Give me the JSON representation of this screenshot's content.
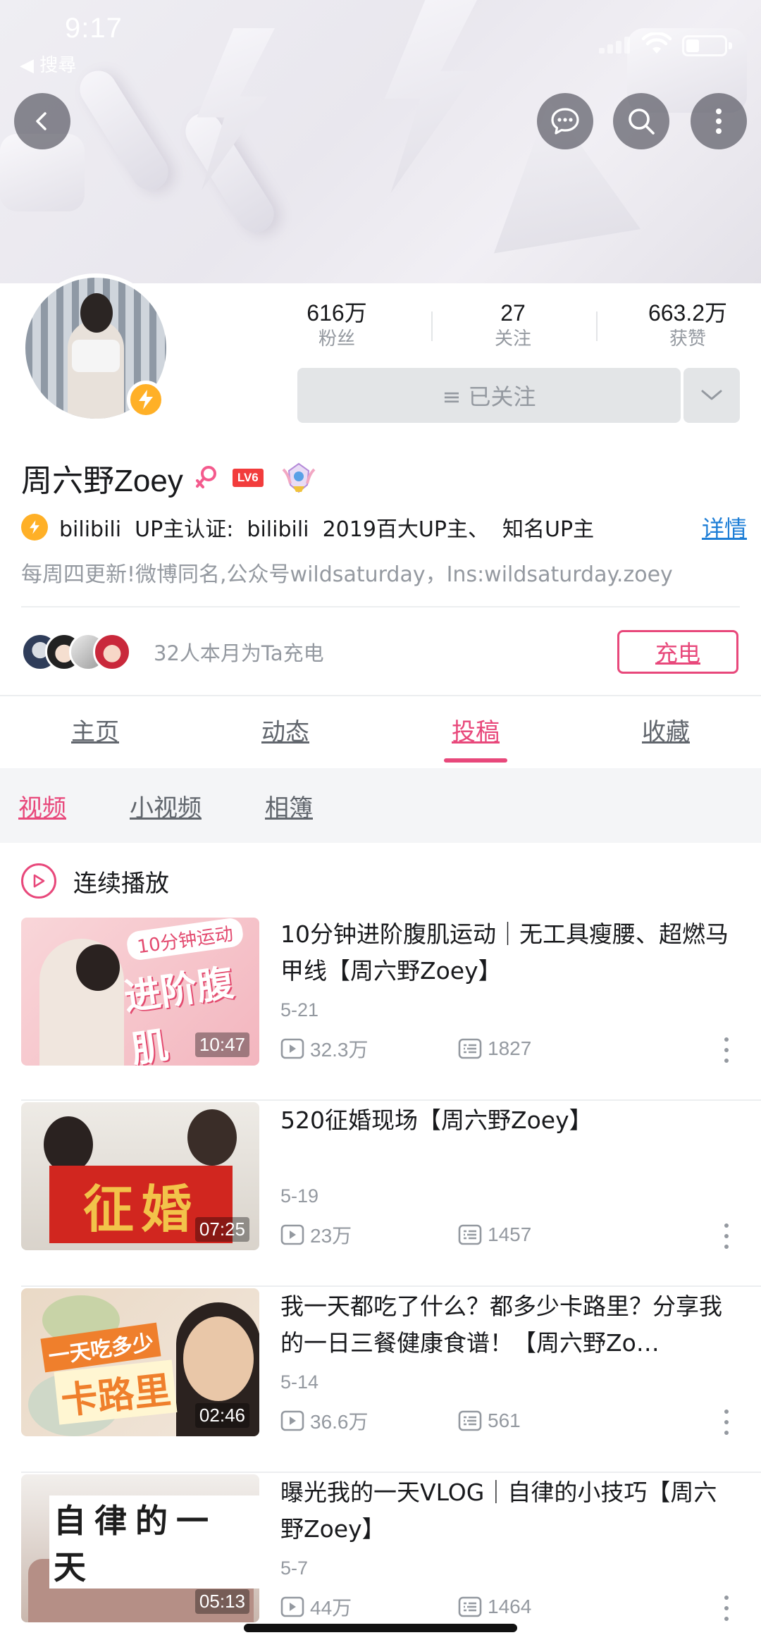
{
  "status_bar": {
    "time": "9:17",
    "back_label": "◀ 搜尋"
  },
  "profile": {
    "stats": [
      {
        "value": "616万",
        "label": "粉丝"
      },
      {
        "value": "27",
        "label": "关注"
      },
      {
        "value": "663.2万",
        "label": "获赞"
      }
    ],
    "follow_button_label": "≡ 已关注",
    "name": "周六野Zoey",
    "level_badge": "LV6",
    "verify_text": "bilibili  UP主认证:  bilibili  2019百大UP主、  知名UP主",
    "detail_link": "详情",
    "bio": "每周四更新!微博同名,公众号wildsaturday，Ins:wildsaturday.zoey",
    "charge_text": "32人本月为Ta充电",
    "charge_button": "充电"
  },
  "main_tabs": [
    {
      "label": "主页",
      "active": false
    },
    {
      "label": "动态",
      "active": false
    },
    {
      "label": "投稿",
      "active": true
    },
    {
      "label": "收藏",
      "active": false
    }
  ],
  "sub_tabs": [
    {
      "label": "视频",
      "active": true
    },
    {
      "label": "小视频",
      "active": false
    },
    {
      "label": "相簿",
      "active": false
    }
  ],
  "autoplay_label": "连续播放",
  "videos": [
    {
      "title": "10分钟进阶腹肌运动｜无工具瘦腰、超燃马甲线【周六野Zoey】",
      "duration": "10:47",
      "date": "5-21",
      "plays": "32.3万",
      "danmaku": "1827",
      "thumb_text_1": "10分钟运动",
      "thumb_text_2": "进阶腹肌"
    },
    {
      "title": "520征婚现场【周六野Zoey】",
      "duration": "07:25",
      "date": "5-19",
      "plays": "23万",
      "danmaku": "1457",
      "thumb_text_1": "征婚"
    },
    {
      "title": "我一天都吃了什么？都多少卡路里？分享我的一日三餐健康食谱！【周六野Zo…",
      "duration": "02:46",
      "date": "5-14",
      "plays": "36.6万",
      "danmaku": "561",
      "thumb_text_1": "一天吃多少",
      "thumb_text_2": "卡路里"
    },
    {
      "title": "曝光我的一天VLOG｜自律的小技巧【周六野Zoey】",
      "duration": "05:13",
      "date": "5-7",
      "plays": "44万",
      "danmaku": "1464",
      "thumb_text_1": "自律的一天"
    }
  ],
  "colors": {
    "accent": "#e8487b",
    "link": "#1e7ed6",
    "muted": "#9499a0",
    "badge": "#ffb027"
  },
  "icons": [
    "back-icon",
    "message-icon",
    "search-icon",
    "more-vertical-icon",
    "lightning-icon",
    "female-icon",
    "chevron-down-icon",
    "play-circle-icon",
    "play-count-icon",
    "danmaku-icon"
  ]
}
